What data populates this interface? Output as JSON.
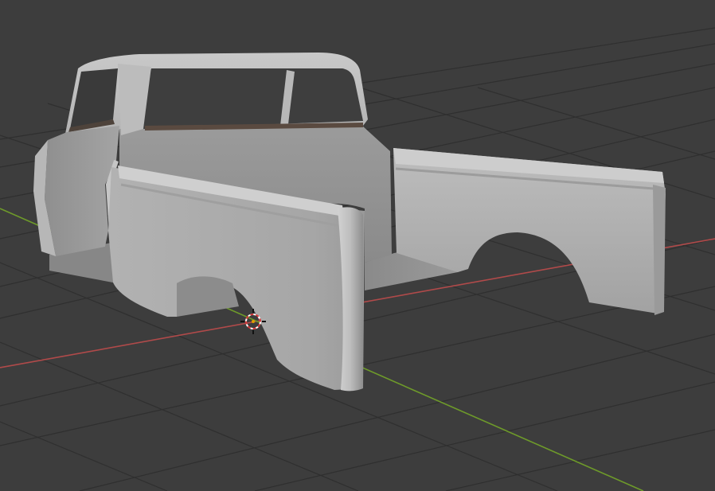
{
  "viewport": {
    "background": "#3d3d3d",
    "grid_color": "#2f2f2f",
    "x_axis_color": "#b04a4a",
    "y_axis_color": "#6e9a2a"
  },
  "scene": {
    "object": "pickup-truck-cab-and-bed-shell",
    "cursor_icon": "3d-cursor-icon"
  }
}
